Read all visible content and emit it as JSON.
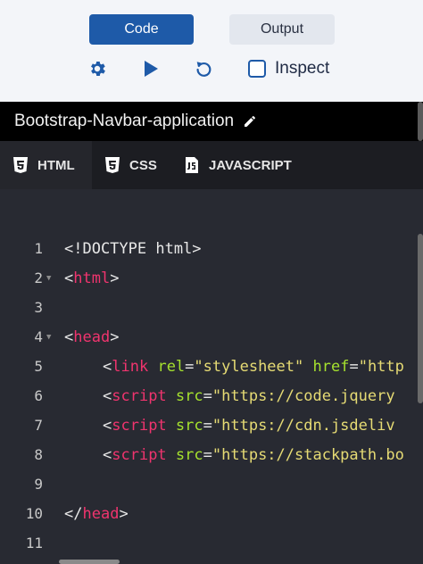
{
  "toolbar": {
    "tabs": [
      {
        "label": "Code",
        "active": true
      },
      {
        "label": "Output",
        "active": false
      }
    ],
    "icons": [
      "gear-icon",
      "play-icon",
      "reset-icon"
    ],
    "inspect_label": "Inspect",
    "inspect_checked": false
  },
  "project": {
    "title": "Bootstrap-Navbar-application"
  },
  "file_tabs": [
    {
      "label": "HTML",
      "active": true
    },
    {
      "label": "CSS",
      "active": false
    },
    {
      "label": "JAVASCRIPT",
      "active": false
    }
  ],
  "editor": {
    "lines": [
      {
        "num": "1",
        "fold": false
      },
      {
        "num": "2",
        "fold": true
      },
      {
        "num": "3",
        "fold": false
      },
      {
        "num": "4",
        "fold": true
      },
      {
        "num": "5",
        "fold": false
      },
      {
        "num": "6",
        "fold": false
      },
      {
        "num": "7",
        "fold": false
      },
      {
        "num": "8",
        "fold": false
      },
      {
        "num": "9",
        "fold": false
      },
      {
        "num": "10",
        "fold": false
      },
      {
        "num": "11",
        "fold": false
      }
    ],
    "code": {
      "l1": "<!DOCTYPE html>",
      "l2_open": "<",
      "l2_tag": "html",
      "l2_close": ">",
      "l4_open": "<",
      "l4_tag": "head",
      "l4_close": ">",
      "l5_open": "<",
      "l5_tag": "link",
      "l5_attr1": "rel",
      "l5_eq1": "=",
      "l5_val1": "\"stylesheet\"",
      "l5_attr2": "href",
      "l5_eq2": "=",
      "l5_val2": "\"http",
      "l6_open": "<",
      "l6_tag": "script",
      "l6_attr": "src",
      "l6_eq": "=",
      "l6_val": "\"https://code.jquery",
      "l7_open": "<",
      "l7_tag": "script",
      "l7_attr": "src",
      "l7_eq": "=",
      "l7_val": "\"https://cdn.jsdeliv",
      "l8_open": "<",
      "l8_tag": "script",
      "l8_attr": "src",
      "l8_eq": "=",
      "l8_val": "\"https://stackpath.bo",
      "l10_open": "</",
      "l10_tag": "head",
      "l10_close": ">"
    }
  },
  "colors": {
    "accent": "#1e5aa8",
    "tag": "#f0346e",
    "attr": "#a6e22e",
    "string": "#e6db74",
    "editor_bg": "#282a32"
  }
}
